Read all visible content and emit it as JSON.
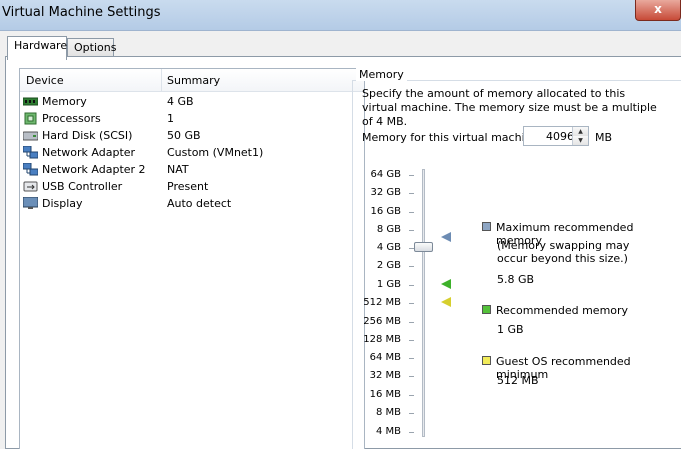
{
  "window": {
    "title": "Virtual Machine Settings",
    "close": "x"
  },
  "tabs": [
    {
      "label": "Hardware"
    },
    {
      "label": "Options"
    }
  ],
  "device_list": {
    "headers": {
      "device": "Device",
      "summary": "Summary"
    },
    "rows": [
      {
        "device": "Memory",
        "summary": "4 GB",
        "icon": "memory-icon"
      },
      {
        "device": "Processors",
        "summary": "1",
        "icon": "processor-icon"
      },
      {
        "device": "Hard Disk (SCSI)",
        "summary": "50 GB",
        "icon": "hard-disk-icon"
      },
      {
        "device": "Network Adapter",
        "summary": "Custom (VMnet1)",
        "icon": "network-adapter-icon"
      },
      {
        "device": "Network Adapter 2",
        "summary": "NAT",
        "icon": "network-adapter-icon"
      },
      {
        "device": "USB Controller",
        "summary": "Present",
        "icon": "usb-icon"
      },
      {
        "device": "Display",
        "summary": "Auto detect",
        "icon": "display-icon"
      }
    ]
  },
  "memory": {
    "group_title": "Memory",
    "description": "Specify the amount of memory allocated to this virtual machine. The memory size must be a multiple of 4 MB.",
    "field_label": "Memory for this virtual machine:",
    "value": "4096",
    "unit": "MB",
    "scale": [
      "64 GB",
      "32 GB",
      "16 GB",
      "8 GB",
      "4 GB",
      "2 GB",
      "1 GB",
      "512 MB",
      "256 MB",
      "128 MB",
      "64 MB",
      "32 MB",
      "16 MB",
      "8 MB",
      "4 MB"
    ],
    "selected_scale_label": "4 GB",
    "legend": {
      "max": {
        "label": "Maximum recommended memory",
        "note_line1": "(Memory swapping may",
        "note_line2": "occur beyond this size.)",
        "value": "5.8 GB",
        "color": "#8ea6c4"
      },
      "recommended": {
        "label": "Recommended memory",
        "value": "1 GB",
        "color": "#54c13a"
      },
      "guest_min": {
        "label": "Guest OS recommended minimum",
        "value": "512 MB",
        "color": "#f2ec5a"
      }
    }
  }
}
